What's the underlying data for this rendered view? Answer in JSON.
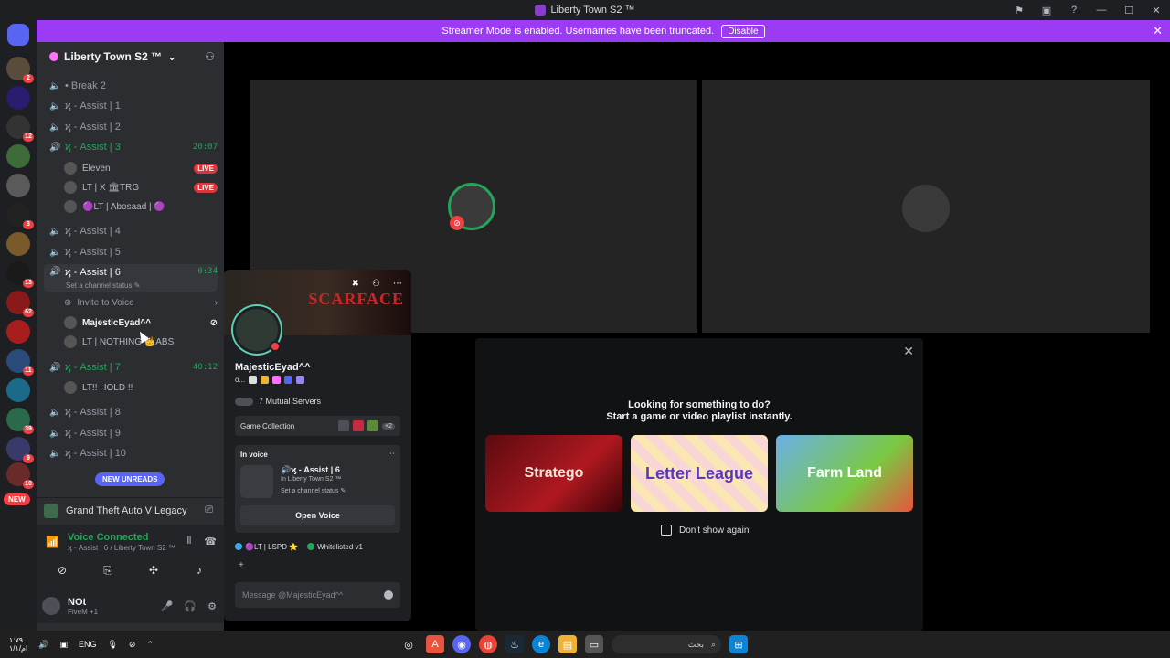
{
  "window": {
    "title": "Liberty Town S2 ™",
    "icons": [
      "flag-icon",
      "record-icon",
      "help-icon",
      "minimize-icon",
      "maximize-icon",
      "close-icon"
    ]
  },
  "streamer_banner": {
    "text": "Streamer Mode is enabled. Usernames have been truncated.",
    "button": "Disable"
  },
  "server": {
    "name": "Liberty Town S2 ™"
  },
  "guild_badges": [
    "2",
    "12",
    "3",
    "13",
    "62",
    "11",
    "39",
    "9",
    "10"
  ],
  "channels": [
    {
      "name": "• Break 2",
      "time": ""
    },
    {
      "name": "ϗ - Assist | 1",
      "time": ""
    },
    {
      "name": "ϗ - Assist | 2",
      "time": ""
    },
    {
      "name": "ϗ - Assist | 3",
      "time": "20:07"
    },
    {
      "name": "ϗ - Assist | 4",
      "time": ""
    },
    {
      "name": "ϗ - Assist | 5",
      "time": ""
    },
    {
      "name": "ϗ - Assist | 6",
      "time": "0:34"
    },
    {
      "name": "ϗ - Assist | 7",
      "time": "40:12"
    },
    {
      "name": "ϗ - Assist | 8",
      "time": ""
    },
    {
      "name": "ϗ - Assist | 9",
      "time": ""
    },
    {
      "name": "ϗ - Assist | 10",
      "time": ""
    }
  ],
  "assist3_users": [
    {
      "name": "Eleven",
      "live": "LIVE"
    },
    {
      "name": "LT | X 🏛TRG",
      "live": "LIVE"
    },
    {
      "name": "🟣LT | Abosaad | 🟣",
      "live": ""
    }
  ],
  "assist6": {
    "status": "Set a channel status ✎",
    "invite": "Invite to Voice",
    "users": [
      "MajesticEyad^^",
      "LT | NOTHING 👑ABS"
    ]
  },
  "assist7_users": [
    "LT!! HOLD !!"
  ],
  "new_pill": "NEW",
  "unreads": "NEW UNREADS",
  "activity": {
    "game": "Grand Theft Auto V Legacy"
  },
  "voice": {
    "status": "Voice Connected",
    "channel": "ϗ - Assist | 6 / Liberty Town S2 ™"
  },
  "userbar": {
    "name": "NOt",
    "status": "FiveM +1"
  },
  "popout": {
    "line1": "Looking for something to do?",
    "line2": "Start a game or video playlist instantly.",
    "games": [
      "Stratego",
      "Letter League",
      "Farm Land"
    ],
    "dont_show": "Don't show again"
  },
  "profile": {
    "banner_text": "SCARFACE",
    "name": "MajesticEyad^^",
    "tag_prefix": "o...",
    "mutual": "7 Mutual Servers",
    "game_collection": "Game Collection",
    "more_games": "+2",
    "in_voice": "In voice",
    "voice_channel": "🔊ϗ - Assist | 6",
    "voice_server": "In Liberty Town S2 ™",
    "voice_status": "Set a channel status ✎",
    "open_voice": "Open Voice",
    "role1": "🟣LT | LSPD ⭐",
    "role2": "Whitelisted v1",
    "add_role": "+",
    "message_placeholder": "Message @MajesticEyad^^"
  },
  "taskbar": {
    "clock_time": "١:٧٩",
    "clock_date": "ام/١/١",
    "lang": "ENG",
    "search_text": "بحث"
  },
  "colors": {
    "accent": "#9b3bf3",
    "voice_green": "#23a55a",
    "live_red": "#da373c",
    "blurple": "#5865f2"
  }
}
